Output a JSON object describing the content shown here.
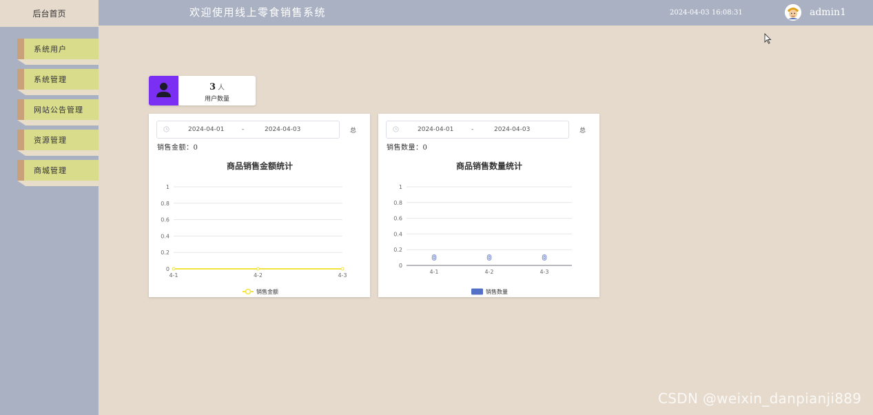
{
  "header": {
    "home_tab": "后台首页",
    "app_title": "欢迎使用线上零食销售系统",
    "datetime": "2024-04-03 16:08:31",
    "username": "admin1"
  },
  "sidebar": {
    "items": [
      {
        "label": "系统用户"
      },
      {
        "label": "系统管理"
      },
      {
        "label": "网站公告管理"
      },
      {
        "label": "资源管理"
      },
      {
        "label": "商城管理"
      }
    ]
  },
  "stats": {
    "user_count": "3",
    "user_unit": "人",
    "user_label": "用户数量",
    "icon_color": "#7b2ff2"
  },
  "sales_amount_panel": {
    "date_start": "2024-04-01",
    "date_sep": "-",
    "date_end": "2024-04-03",
    "total_button": "总",
    "summary": "销售金额：0"
  },
  "sales_count_panel": {
    "date_start": "2024-04-01",
    "date_sep": "-",
    "date_end": "2024-04-03",
    "total_button": "总",
    "summary": "销售数量：0"
  },
  "watermark": "CSDN @weixin_danpianji889",
  "chart_data": [
    {
      "type": "line",
      "title": "商品销售金额统计",
      "categories": [
        "4-1",
        "4-2",
        "4-3"
      ],
      "series": [
        {
          "name": "销售金额",
          "values": [
            0,
            0,
            0
          ],
          "color": "#f2e33a"
        }
      ],
      "ylim": [
        0,
        1
      ],
      "yticks": [
        "0",
        "0.2",
        "0.4",
        "0.6",
        "0.8",
        "1"
      ],
      "grid": true,
      "legend": "bottom"
    },
    {
      "type": "bar",
      "title": "商品销售数量统计",
      "categories": [
        "4-1",
        "4-2",
        "4-3"
      ],
      "series": [
        {
          "name": "销售数量",
          "values": [
            0,
            0,
            0
          ],
          "color": "#5470c6"
        }
      ],
      "data_labels": [
        "0",
        "0",
        "0"
      ],
      "ylim": [
        0,
        1
      ],
      "yticks": [
        "0",
        "0.2",
        "0.4",
        "0.6",
        "0.8",
        "1"
      ],
      "grid": true,
      "legend": "bottom"
    }
  ]
}
